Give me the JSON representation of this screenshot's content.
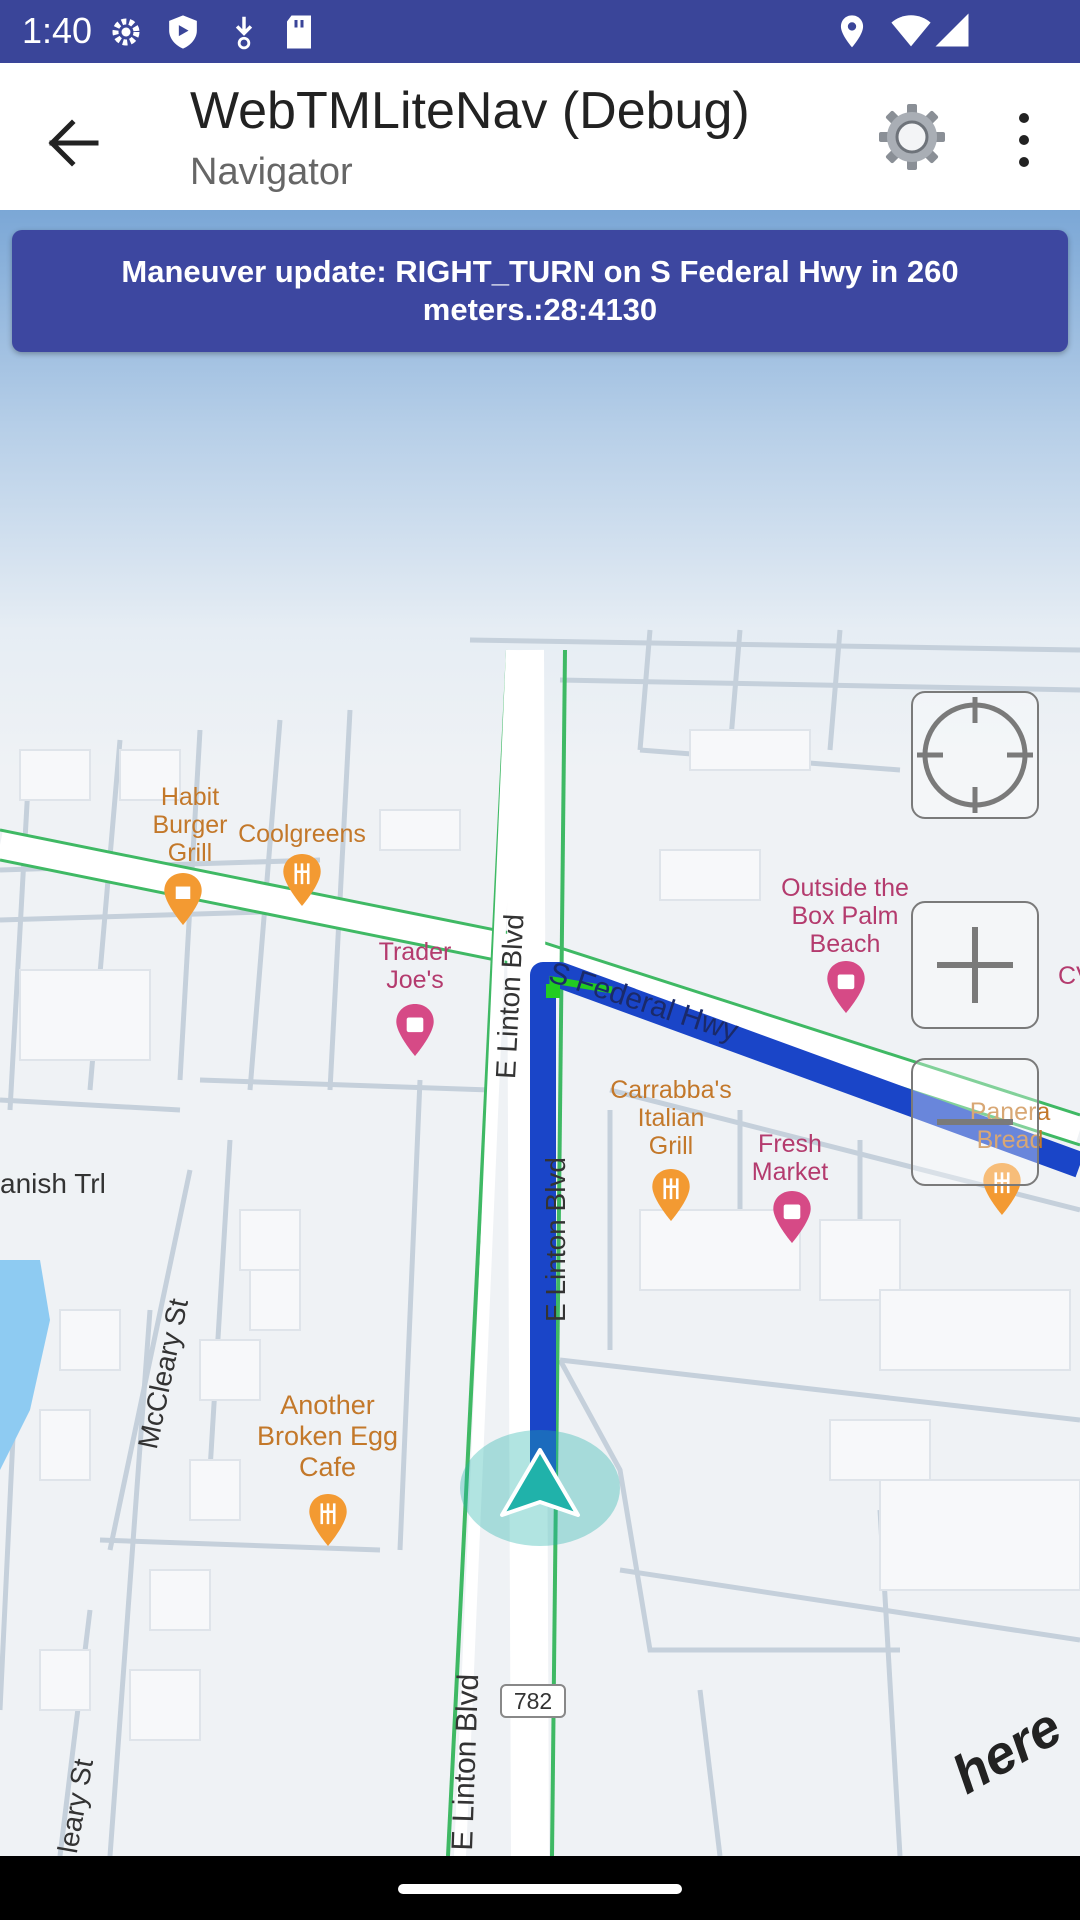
{
  "status_bar": {
    "time": "1:40",
    "icons": [
      "settings-icon",
      "shield-icon",
      "download-icon",
      "sd-card-icon",
      "location-icon",
      "wifi-icon",
      "signal-icon"
    ]
  },
  "app_bar": {
    "title": "WebTMLiteNav (Debug)",
    "subtitle": "Navigator",
    "icons": [
      "back-arrow-icon",
      "gear-icon",
      "more-vert-icon"
    ]
  },
  "banner": {
    "text": "Maneuver update: RIGHT_TURN on S Federal Hwy in 260 meters.:28:4130"
  },
  "map": {
    "colors": {
      "route": "#1a45c8",
      "route_ahead": "#22cc22",
      "marker": "#20b2aa",
      "food_poi": "#f39a32",
      "shop_poi": "#d64a86"
    },
    "streets": {
      "linton_upper": "E Linton Blvd",
      "linton_route": "E Linton Blvd",
      "linton_lower": "E Linton Blvd",
      "federal": "S Federal Hwy",
      "spanish": "anish Trl",
      "mccleary_upper": "McCleary St",
      "mccleary_lower": "leary St"
    },
    "route_shield": "782",
    "pois": {
      "habit": "Habit\nBurger\nGrill",
      "coolgreens": "Coolgreens",
      "trader": "Trader\nJoe's",
      "outside": "Outside the\nBox Palm\nBeach",
      "carrabba": "Carrabba's\nItalian\nGrill",
      "fresh": "Fresh\nMarket",
      "panera": "Panera\nBread",
      "another": "Another\nBroken Egg\nCafe",
      "cv": "CV"
    },
    "controls": [
      "recenter-icon",
      "zoom-in-icon",
      "zoom-out-icon"
    ],
    "logo": "here"
  }
}
